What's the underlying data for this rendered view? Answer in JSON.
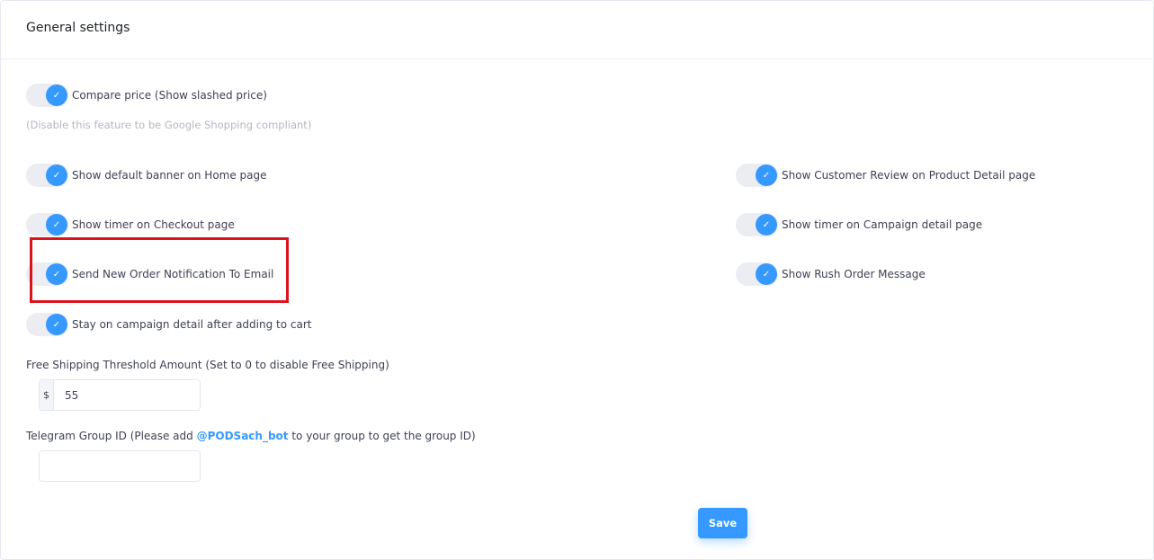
{
  "header": {
    "title": "General settings"
  },
  "toggles": {
    "compare_price": {
      "label": "Compare price (Show slashed price)",
      "checked": true
    },
    "hint": "(Disable this feature to be Google Shopping compliant)",
    "default_banner": {
      "label": "Show default banner on Home page",
      "checked": true
    },
    "customer_review": {
      "label": "Show Customer Review on Product Detail page",
      "checked": true
    },
    "timer_checkout": {
      "label": "Show timer on Checkout page",
      "checked": true
    },
    "timer_campaign": {
      "label": "Show timer on Campaign detail page",
      "checked": true
    },
    "order_notification": {
      "label": "Send New Order Notification To Email",
      "checked": true
    },
    "rush_order": {
      "label": "Show Rush Order Message",
      "checked": true
    },
    "stay_on_campaign": {
      "label": "Stay on campaign detail after adding to cart",
      "checked": true
    }
  },
  "check_glyph": "✓",
  "free_shipping": {
    "label": "Free Shipping Threshold Amount (Set to 0 to disable Free Shipping)",
    "currency": "$",
    "value": "55"
  },
  "telegram": {
    "label_before": "Telegram Group ID (Please add ",
    "bot_name": "@PODSach_bot",
    "label_after": " to your group to get the group ID)",
    "value": ""
  },
  "save_label": "Save",
  "colors": {
    "accent": "#3699ff",
    "highlight": "#d9141c"
  }
}
